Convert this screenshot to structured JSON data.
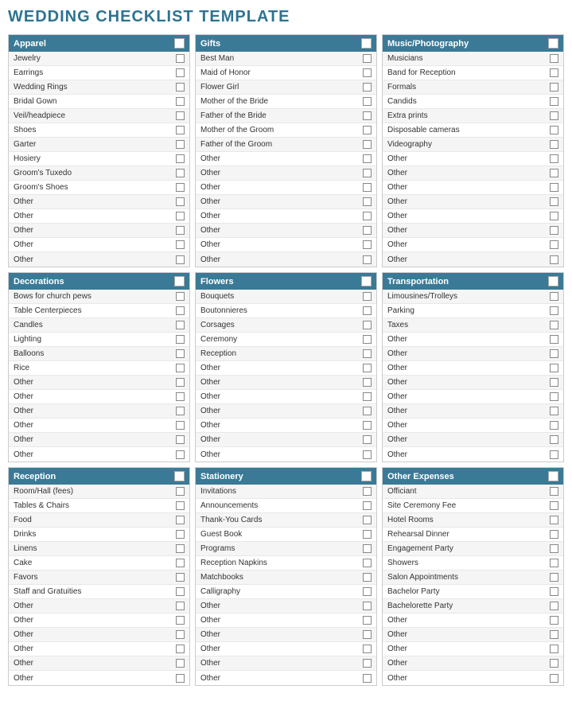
{
  "title": "WEDDING CHECKLIST TEMPLATE",
  "sections": [
    {
      "id": "apparel",
      "header": "Apparel",
      "items": [
        "Jewelry",
        "Earrings",
        "Wedding Rings",
        "Bridal Gown",
        "Veil/headpiece",
        "Shoes",
        "Garter",
        "Hosiery",
        "Groom's Tuxedo",
        "Groom's Shoes",
        "Other",
        "Other",
        "Other",
        "Other",
        "Other"
      ]
    },
    {
      "id": "gifts",
      "header": "Gifts",
      "items": [
        "Best Man",
        "Maid of Honor",
        "Flower Girl",
        "Mother of the Bride",
        "Father of the Bride",
        "Mother of the Groom",
        "Father of the Groom",
        "Other",
        "Other",
        "Other",
        "Other",
        "Other",
        "Other",
        "Other",
        "Other"
      ]
    },
    {
      "id": "music-photography",
      "header": "Music/Photography",
      "items": [
        "Musicians",
        "Band for Reception",
        "Formals",
        "Candids",
        "Extra prints",
        "Disposable cameras",
        "Videography",
        "Other",
        "Other",
        "Other",
        "Other",
        "Other",
        "Other",
        "Other",
        "Other"
      ]
    },
    {
      "id": "decorations",
      "header": "Decorations",
      "items": [
        "Bows for church pews",
        "Table Centerpieces",
        "Candles",
        "Lighting",
        "Balloons",
        "Rice",
        "Other",
        "Other",
        "Other",
        "Other",
        "Other",
        "Other"
      ]
    },
    {
      "id": "flowers",
      "header": "Flowers",
      "items": [
        "Bouquets",
        "Boutonnieres",
        "Corsages",
        "Ceremony",
        "Reception",
        "Other",
        "Other",
        "Other",
        "Other",
        "Other",
        "Other",
        "Other"
      ]
    },
    {
      "id": "transportation",
      "header": "Transportation",
      "items": [
        "Limousines/Trolleys",
        "Parking",
        "Taxes",
        "Other",
        "Other",
        "Other",
        "Other",
        "Other",
        "Other",
        "Other",
        "Other",
        "Other"
      ]
    },
    {
      "id": "reception",
      "header": "Reception",
      "items": [
        "Room/Hall (fees)",
        "Tables & Chairs",
        "Food",
        "Drinks",
        "Linens",
        "Cake",
        "Favors",
        "Staff and Gratuities",
        "Other",
        "Other",
        "Other",
        "Other",
        "Other",
        "Other"
      ]
    },
    {
      "id": "stationery",
      "header": "Stationery",
      "items": [
        "Invitations",
        "Announcements",
        "Thank-You Cards",
        "Guest Book",
        "Programs",
        "Reception Napkins",
        "Matchbooks",
        "Calligraphy",
        "Other",
        "Other",
        "Other",
        "Other",
        "Other",
        "Other"
      ]
    },
    {
      "id": "other-expenses",
      "header": "Other Expenses",
      "items": [
        "Officiant",
        "Site Ceremony Fee",
        "Hotel Rooms",
        "Rehearsal Dinner",
        "Engagement Party",
        "Showers",
        "Salon Appointments",
        "Bachelor Party",
        "Bachelorette Party",
        "Other",
        "Other",
        "Other",
        "Other",
        "Other"
      ]
    }
  ]
}
